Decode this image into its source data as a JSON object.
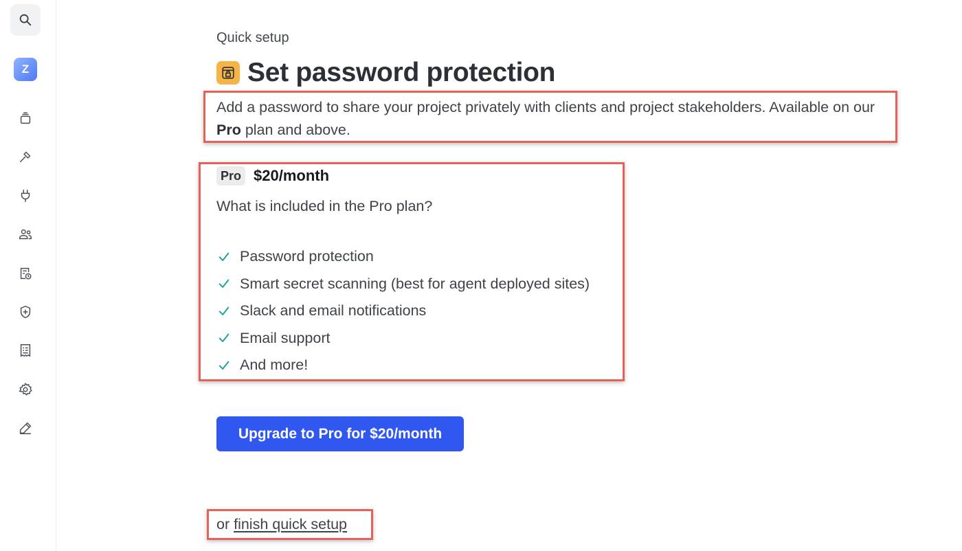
{
  "sidebar": {
    "avatar_initial": "Z",
    "items": [
      {
        "name": "search-icon"
      },
      {
        "name": "projects-icon"
      },
      {
        "name": "build-icon"
      },
      {
        "name": "integrations-icon"
      },
      {
        "name": "team-icon"
      },
      {
        "name": "usage-icon"
      },
      {
        "name": "security-icon"
      },
      {
        "name": "billing-icon"
      },
      {
        "name": "settings-icon"
      },
      {
        "name": "edit-icon"
      }
    ]
  },
  "main": {
    "eyebrow": "Quick setup",
    "title": "Set password protection",
    "title_icon": "lock-window-icon",
    "description_before": "Add a password to share your project privately with clients and project stakeholders. Available on our ",
    "description_bold": "Pro",
    "description_after": " plan and above.",
    "plan_badge": "Pro",
    "price": "$20/month",
    "question": "What is included in the Pro plan?",
    "features": [
      "Password protection",
      "Smart secret scanning (best for agent deployed sites)",
      "Slack and email notifications",
      "Email support",
      "And more!"
    ],
    "cta_label": "Upgrade to Pro for $20/month",
    "finish_prefix": "or ",
    "finish_link": "finish quick setup"
  },
  "colors": {
    "accent": "#3057f0",
    "check": "#1aa39a",
    "highlight": "#e8605a",
    "title_icon_bg": "#f6b447"
  }
}
